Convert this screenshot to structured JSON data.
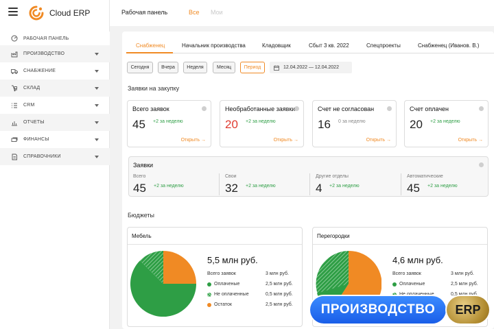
{
  "app": {
    "name": "Cloud ERP"
  },
  "sidebar": {
    "items": [
      {
        "label": "Рабочая панель",
        "icon": "gauge-icon"
      },
      {
        "label": "Производство",
        "icon": "factory-icon"
      },
      {
        "label": "Снабжение",
        "icon": "truck-icon"
      },
      {
        "label": "Склад",
        "icon": "dolly-icon"
      },
      {
        "label": "CRM",
        "icon": "checklist-icon"
      },
      {
        "label": "Отчеты",
        "icon": "chart-icon"
      },
      {
        "label": "Финансы",
        "icon": "money-icon"
      },
      {
        "label": "Справочники",
        "icon": "book-icon"
      }
    ]
  },
  "topbar": {
    "title": "Рабочая панель",
    "tab_all": "Все",
    "tab_mine": "Мои"
  },
  "tabs": [
    "Снабженец",
    "Начальник производства",
    "Кладовщик",
    "Сбыт 3 кв. 2022",
    "Спецпроекты",
    "Снабженец (Иванов. В.)"
  ],
  "filters": {
    "buttons": [
      "Сегодня",
      "Вчера",
      "Неделя",
      "Месяц",
      "Период"
    ],
    "active": "Период",
    "date_range": "12.04.2022 — 12.04.2022"
  },
  "purchase": {
    "title": "Заявки на закупку",
    "cards": [
      {
        "title": "Всего заявок",
        "value": "45",
        "delta": "+2 за неделю",
        "link": "Открыть →"
      },
      {
        "title": "Необработанные заявки",
        "value": "20",
        "delta": "+2 за неделю",
        "link": "Открыть →"
      },
      {
        "title": "Счет не согласован",
        "value": "16",
        "delta": "0 за неделю",
        "link": "Открыть →"
      },
      {
        "title": "Счет оплачен",
        "value": "20",
        "delta": "+2 за неделю",
        "link": "Открыть →"
      }
    ]
  },
  "zayavki": {
    "title": "Заявки",
    "cols": [
      {
        "label": "Всего",
        "value": "45",
        "delta": "+2 за неделю"
      },
      {
        "label": "Свои",
        "value": "32",
        "delta": "+2 за неделю"
      },
      {
        "label": "Другие отделы",
        "value": "4",
        "delta": "+2 за неделю"
      },
      {
        "label": "Автоматические",
        "value": "45",
        "delta": "+2 за неделю"
      }
    ]
  },
  "budgets": {
    "title": "Бюджеты",
    "items": [
      {
        "name": "Мебель",
        "total": "5,5 млн руб.",
        "rows": [
          {
            "label": "Всего заявок",
            "value": "3 млн руб."
          },
          {
            "label": "Оплаченые",
            "value": "2,5 млн руб."
          },
          {
            "label": "Не оплаченные",
            "value": "0,5 млн руб."
          },
          {
            "label": "Остаток",
            "value": "2,5 млн руб."
          }
        ]
      },
      {
        "name": "Перегородки",
        "total": "4,6 млн руб.",
        "rows": [
          {
            "label": "Всего заявок",
            "value": "3 млн руб."
          },
          {
            "label": "Оплаченые",
            "value": "2,5 млн руб."
          },
          {
            "label": "Не оплаченные",
            "value": "0,5 млн руб."
          }
        ]
      }
    ]
  },
  "colors": {
    "accent": "#f08a24",
    "green": "#2e9e45",
    "red": "#e03a2f",
    "blue": "#1a5ee8"
  },
  "promo": {
    "label": "ПРОИЗВОДСТВО",
    "badge": "ERP"
  }
}
